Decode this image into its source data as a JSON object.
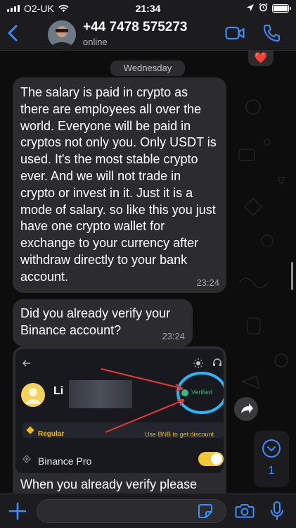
{
  "status_bar": {
    "carrier": "O2-UK",
    "time": "21:34"
  },
  "header": {
    "contact": "+44 7478 575273",
    "presence": "online"
  },
  "chat": {
    "day_label": "Wednesday",
    "reaction": "❤️",
    "messages": [
      {
        "text": "The salary is paid in crypto as there are employees all over the world. Everyone will be paid in cryptos not only you. Only USDT is used. It's the most stable crypto ever. And we will not trade in crypto or invest in it. Just it is a mode of salary. so like this you just have one crypto wallet for exchange to your currency after withdraw directly to your bank account.",
        "time": "23:24"
      },
      {
        "text": "Did you already verify your Binance account?",
        "time": "23:24"
      },
      {
        "caption": "When you already verify please",
        "embedded": {
          "user_name": "Li",
          "verified": "Verified",
          "tier": "Regular",
          "bnb_discount": "Use BNB to get discount",
          "pro_label": "Binance Pro"
        }
      }
    ],
    "unread_count": "1"
  },
  "colors": {
    "accent": "#3b8dfd",
    "bubble": "#2c2c2e",
    "binance_yellow": "#f0b90b",
    "verified_green": "#2ebd85",
    "annotation_red": "#e53935",
    "annotation_blue": "#29b6f6"
  }
}
